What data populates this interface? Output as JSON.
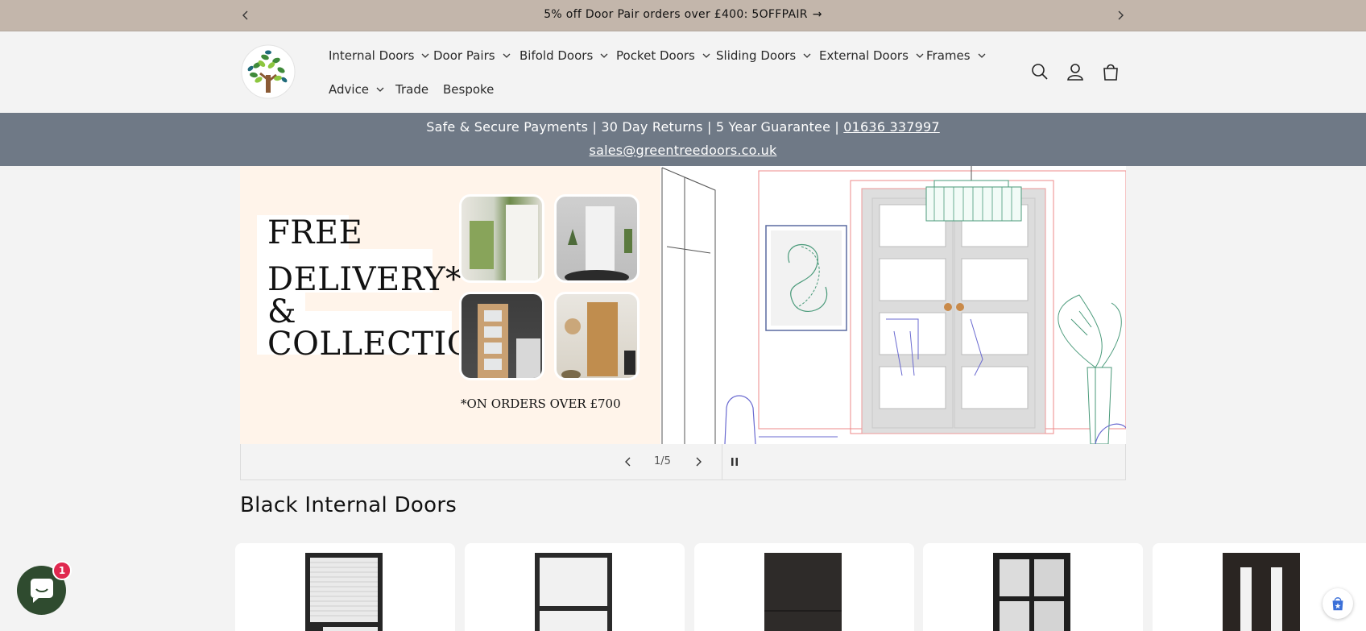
{
  "announcement": {
    "message": "5% off Door Pair orders over £400: 5OFFPAIR",
    "arrow": "→"
  },
  "nav": {
    "items": [
      {
        "label": "Internal Doors"
      },
      {
        "label": "Door Pairs"
      },
      {
        "label": "Bifold Doors"
      },
      {
        "label": "Pocket Doors"
      },
      {
        "label": "Sliding Doors"
      },
      {
        "label": "External Doors"
      },
      {
        "label": "Frames"
      },
      {
        "label": "Advice"
      },
      {
        "label": "Trade"
      },
      {
        "label": "Bespoke"
      }
    ],
    "icons": [
      "search-icon",
      "account-icon",
      "cart-icon"
    ]
  },
  "trust": {
    "text": "Safe & Secure Payments | 30 Day Returns | 5 Year Guarantee | ",
    "phone": "01636 337997",
    "email": "sales@greentreedoors.co.uk"
  },
  "hero": {
    "line1": "FREE",
    "line2": "DELIVERY*",
    "line3": "&",
    "line4": "COLLECTION",
    "footnote": "*ON ORDERS OVER £700"
  },
  "slideshow": {
    "counter": "1/5"
  },
  "collection": {
    "title": "Black Internal Doors"
  },
  "chat": {
    "badge": "1"
  },
  "colors": {
    "announcement_bg": "#c3b6ab",
    "trust_bg": "#6f7986",
    "hero_left_bg": "#fff4ea",
    "chat_bg": "#2f4b2f",
    "badge_bg": "#e0284f"
  }
}
